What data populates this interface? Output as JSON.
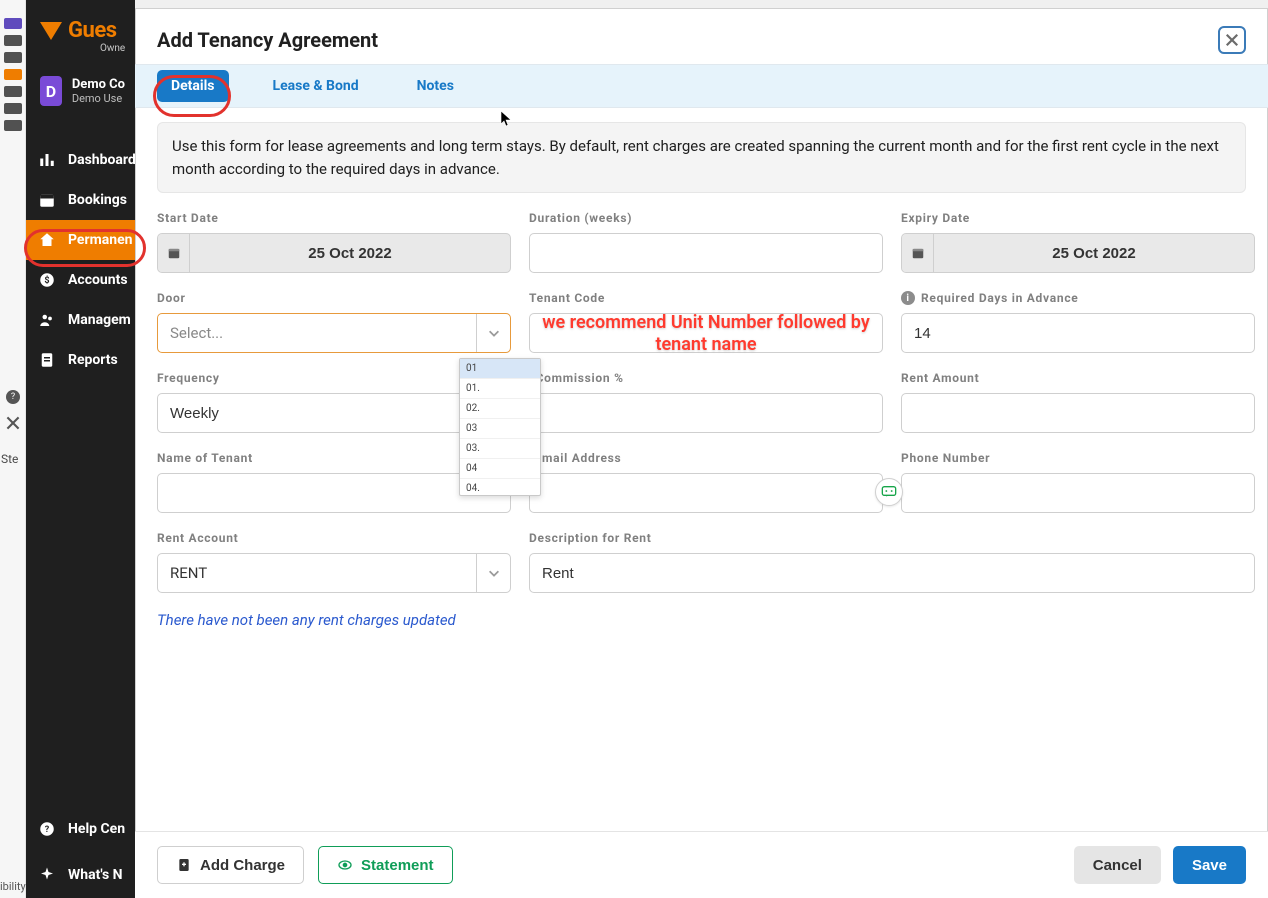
{
  "brand": {
    "name": "Gues",
    "subtitle": "Owne"
  },
  "user": {
    "initial": "D",
    "company": "Demo Co",
    "name": "Demo Use"
  },
  "sidebar": {
    "items": [
      {
        "label": "Dashboard"
      },
      {
        "label": "Bookings"
      },
      {
        "label": "Permanen"
      },
      {
        "label": "Accounts"
      },
      {
        "label": "Managem"
      },
      {
        "label": "Reports"
      }
    ],
    "bottom": [
      {
        "label": "Help Cen"
      },
      {
        "label": "What's N"
      }
    ]
  },
  "leftStubText": "ibility",
  "leftStubSte": "Ste",
  "modal": {
    "title": "Add Tenancy Agreement",
    "tabs": [
      {
        "label": "Details"
      },
      {
        "label": "Lease & Bond"
      },
      {
        "label": "Notes"
      }
    ],
    "info": "Use this form for lease agreements and long term stays. By default, rent charges are created spanning the current month and for the first rent cycle in the next month according to the required days in advance.",
    "fields": {
      "start_date": {
        "label": "Start Date",
        "value": "25 Oct 2022"
      },
      "duration": {
        "label": "Duration (weeks)",
        "value": ""
      },
      "expiry_date": {
        "label": "Expiry Date",
        "value": "25 Oct 2022"
      },
      "door": {
        "label": "Door",
        "placeholder": "Select...",
        "options": [
          "01",
          "01.",
          "02.",
          "03",
          "03.",
          "04",
          "04."
        ]
      },
      "tenant_code": {
        "label": "Tenant Code",
        "value": ""
      },
      "required_days": {
        "label": "Required Days in Advance",
        "value": "14"
      },
      "frequency": {
        "label": "Frequency",
        "value": "Weekly"
      },
      "commission": {
        "label": "Commission %",
        "value": ""
      },
      "rent_amount": {
        "label": "Rent Amount",
        "value": ""
      },
      "tenant_name": {
        "label": "Name of Tenant",
        "value": ""
      },
      "email": {
        "label": "Email Address",
        "value": ""
      },
      "phone": {
        "label": "Phone Number",
        "value": ""
      },
      "rent_account": {
        "label": "Rent Account",
        "value": "RENT"
      },
      "rent_desc": {
        "label": "Description for Rent",
        "value": "Rent"
      }
    },
    "note": "There have not been any rent charges updated",
    "annotation": "we recommend Unit Number followed by tenant name",
    "footer": {
      "add_charge": "Add Charge",
      "statement": "Statement",
      "cancel": "Cancel",
      "save": "Save"
    }
  }
}
